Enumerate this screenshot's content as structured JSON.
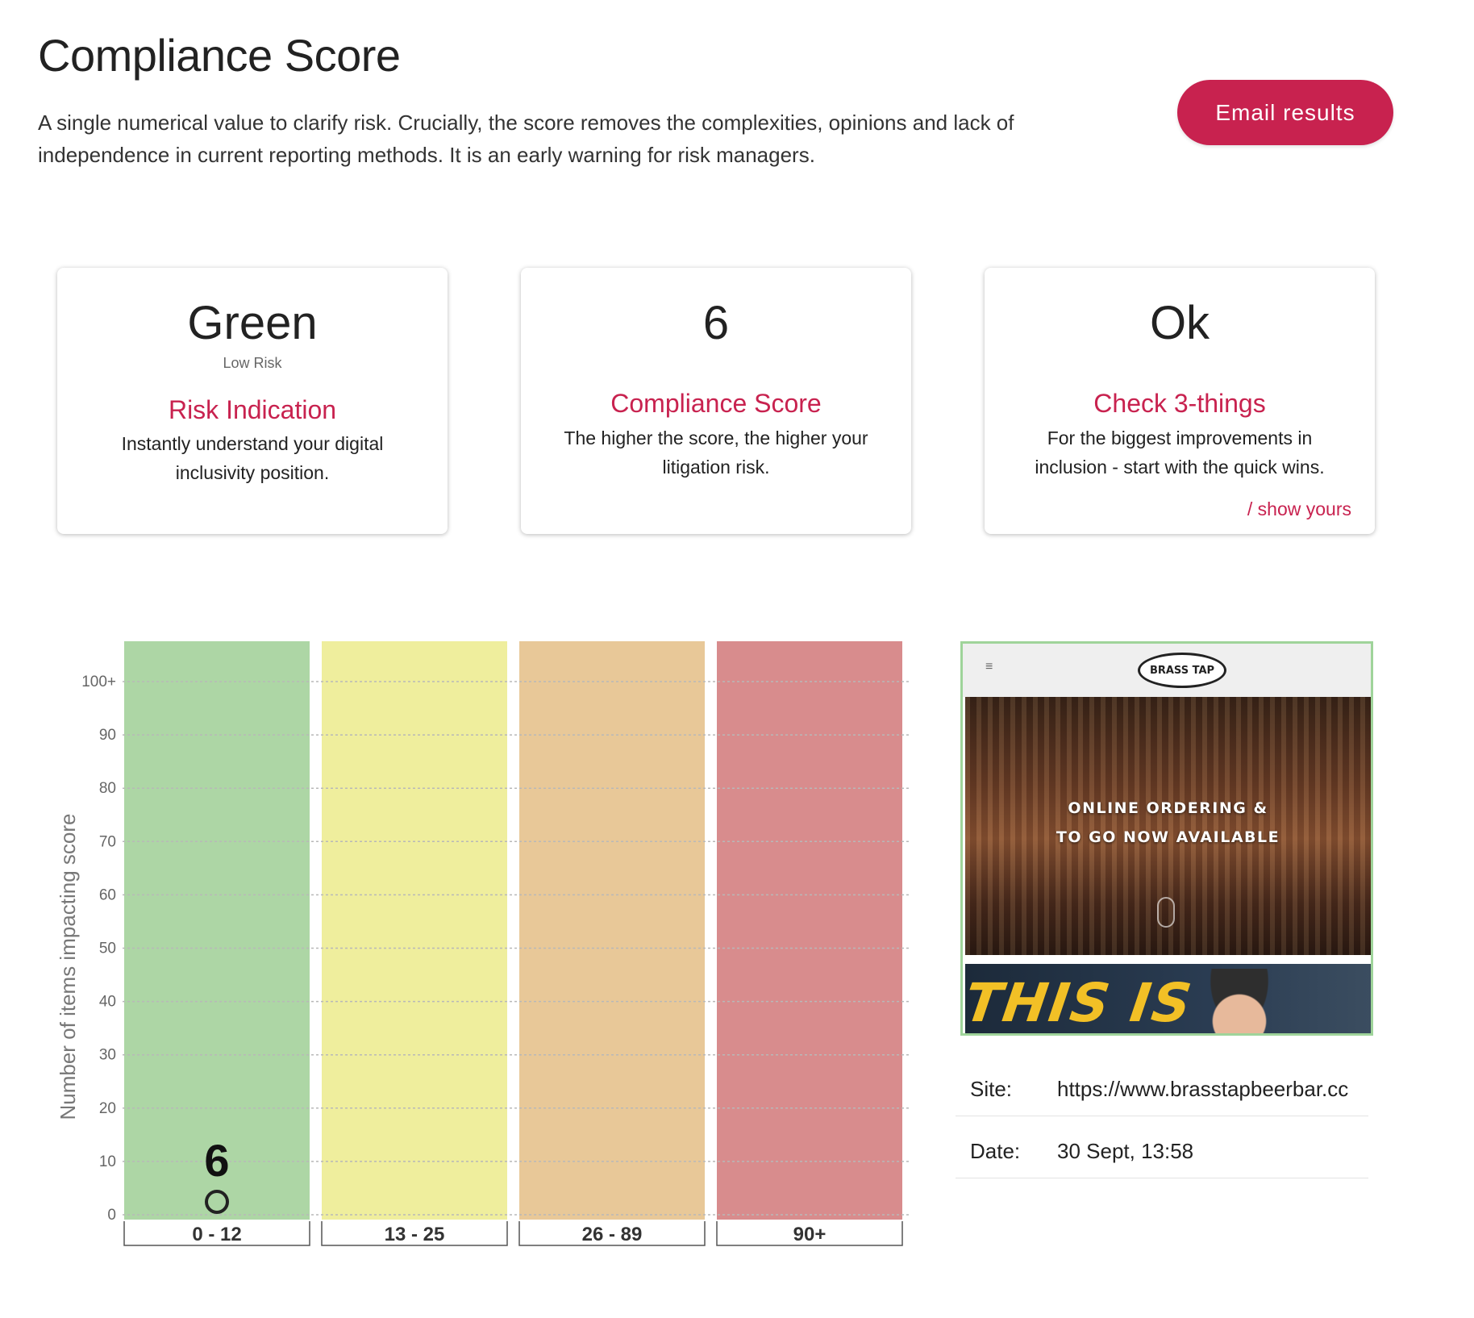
{
  "header": {
    "title": "Compliance Score",
    "description": "A single numerical value to clarify risk. Crucially, the score removes the complexities, opinions and lack of independence in current reporting methods. It is an early warning for risk managers.",
    "email_button": "Email results"
  },
  "cards": [
    {
      "value": "Green",
      "subvalue": "Low Risk",
      "heading": "Risk Indication",
      "description": "Instantly understand your digital inclusivity position."
    },
    {
      "value": "6",
      "heading": "Compliance Score",
      "description": "The higher the score, the higher your litigation risk."
    },
    {
      "value": "Ok",
      "heading": "Check 3-things",
      "description": "For the biggest improvements in inclusion - start with the quick wins.",
      "link": "/ show yours"
    }
  ],
  "chart_data": {
    "type": "bar",
    "ylabel": "Number of items impacting score",
    "y_ticks": [
      "0",
      "10",
      "20",
      "30",
      "40",
      "50",
      "60",
      "70",
      "80",
      "90",
      "100+"
    ],
    "ylim": [
      0,
      100
    ],
    "grid": true,
    "bands": [
      {
        "label": "0 - 12",
        "color": "#add6a5"
      },
      {
        "label": "13 - 25",
        "color": "#efee9d"
      },
      {
        "label": "26 - 89",
        "color": "#e8c898"
      },
      {
        "label": "90+",
        "color": "#d88c8d"
      }
    ],
    "points": [
      {
        "band": "0 - 12",
        "value": 6,
        "label": "6",
        "y": 0
      }
    ]
  },
  "site_preview": {
    "menu_icon": "hamburger-icon",
    "logo_text": "BRASS TAP",
    "hero_text_1": "ONLINE ORDERING &",
    "hero_text_2": "TO GO NOW AVAILABLE",
    "banner_text": "THIS IS"
  },
  "meta": {
    "site_label": "Site:",
    "site_value": "https://www.brasstapbeerbar.cc",
    "date_label": "Date:",
    "date_value": "30 Sept, 13:58"
  },
  "colors": {
    "accent": "#c8224f",
    "preview_border": "#9fd49a"
  }
}
